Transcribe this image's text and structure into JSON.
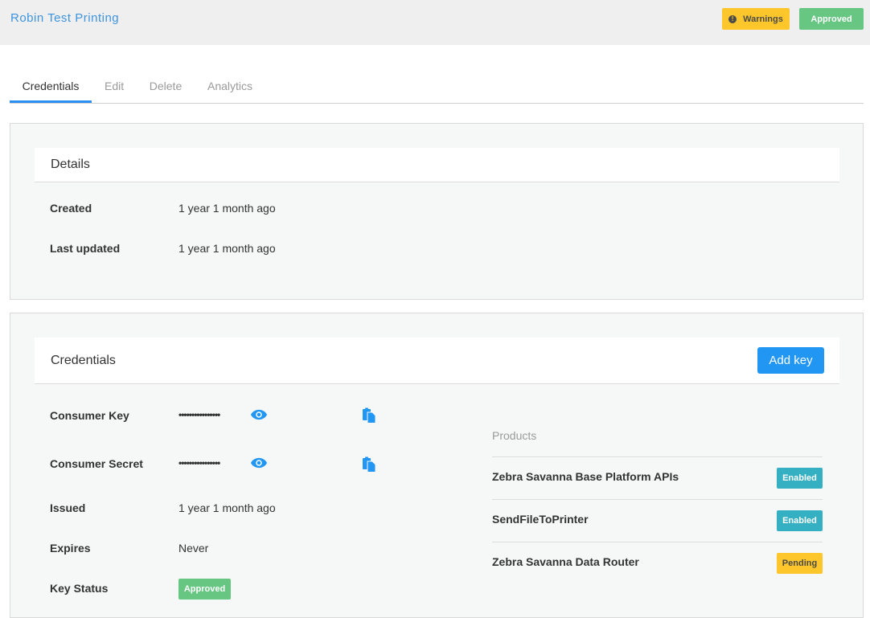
{
  "header": {
    "app_title": "Robin Test Printing",
    "warnings_badge": "Warnings",
    "warnings_icon": "exclamation-circle-icon",
    "approved_badge": "Approved"
  },
  "tabs": [
    {
      "label": "Credentials",
      "active": true
    },
    {
      "label": "Edit",
      "active": false
    },
    {
      "label": "Delete",
      "active": false
    },
    {
      "label": "Analytics",
      "active": false
    }
  ],
  "details": {
    "title": "Details",
    "rows": [
      {
        "label": "Created",
        "value": "1 year 1 month ago"
      },
      {
        "label": "Last updated",
        "value": "1 year 1 month ago"
      }
    ]
  },
  "credentials": {
    "title": "Credentials",
    "add_key_label": "Add key",
    "consumer_key": {
      "label": "Consumer Key",
      "masked_value": "••••••••••••••••"
    },
    "consumer_secret": {
      "label": "Consumer Secret",
      "masked_value": "••••••••••••••••"
    },
    "issued": {
      "label": "Issued",
      "value": "1 year 1 month ago"
    },
    "expires": {
      "label": "Expires",
      "value": "Never"
    },
    "key_status": {
      "label": "Key Status",
      "value": "Approved"
    },
    "products_title": "Products",
    "products": [
      {
        "name": "Zebra Savanna Base Platform APIs",
        "status": "Enabled"
      },
      {
        "name": "SendFileToPrinter",
        "status": "Enabled"
      },
      {
        "name": "Zebra Savanna Data Router",
        "status": "Pending"
      }
    ]
  },
  "colors": {
    "accent": "#2196f3",
    "title_blue": "#3d94e0",
    "approved_green": "#67c682",
    "warning_yellow": "#fdc62b",
    "enabled_teal": "#35afc2"
  }
}
